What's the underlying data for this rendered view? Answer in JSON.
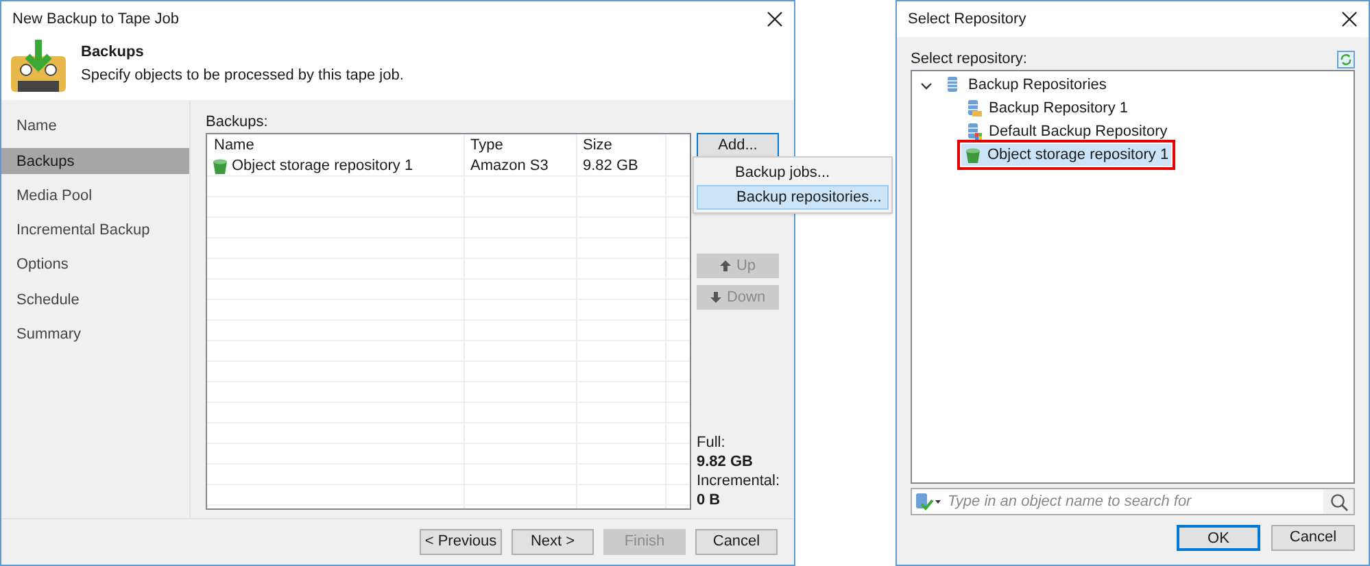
{
  "wizard": {
    "title": "New Backup to Tape Job",
    "header": {
      "title": "Backups",
      "subtitle": "Specify objects to be processed by this tape job."
    },
    "steps": [
      {
        "label": "Name",
        "selected": false
      },
      {
        "label": "Backups",
        "selected": true
      },
      {
        "label": "Media Pool",
        "selected": false
      },
      {
        "label": "Incremental Backup",
        "selected": false
      },
      {
        "label": "Options",
        "selected": false
      },
      {
        "label": "Schedule",
        "selected": false
      },
      {
        "label": "Summary",
        "selected": false
      }
    ],
    "backups_label": "Backups:",
    "table": {
      "columns": [
        "Name",
        "Type",
        "Size"
      ],
      "rows": [
        {
          "name": "Object storage repository 1",
          "type": "Amazon S3",
          "size": "9.82 GB"
        }
      ]
    },
    "side_buttons": [
      {
        "label": "Add...",
        "disabled": false,
        "kind": "plain"
      },
      {
        "label": "Up",
        "disabled": true,
        "kind": "up"
      },
      {
        "label": "Down",
        "disabled": true,
        "kind": "down"
      }
    ],
    "add_menu": [
      {
        "label": "Backup jobs...",
        "selected": false
      },
      {
        "label": "Backup repositories...",
        "selected": true
      }
    ],
    "totals": [
      {
        "label": "Full:",
        "value": "9.82 GB"
      },
      {
        "label": "Incremental:",
        "value": "0 B"
      }
    ],
    "footer_buttons": [
      {
        "label": "< Previous",
        "disabled": false
      },
      {
        "label": "Next >",
        "disabled": false
      },
      {
        "label": "Finish",
        "disabled": true
      },
      {
        "label": "Cancel",
        "disabled": false
      }
    ]
  },
  "repository_dialog": {
    "title": "Select Repository",
    "label": "Select repository:",
    "tree": [
      {
        "label": "Backup Repositories",
        "kind": "group",
        "expanded": true,
        "selected": false,
        "children": [
          {
            "label": "Backup Repository 1",
            "kind": "repository",
            "selected": false
          },
          {
            "label": "Default Backup Repository",
            "kind": "default",
            "selected": false
          },
          {
            "label": "Object storage repository 1",
            "kind": "object",
            "selected": true
          }
        ]
      }
    ],
    "search": {
      "placeholder": "Type in an object name to search for"
    },
    "buttons": [
      {
        "label": "OK",
        "default": true
      },
      {
        "label": "Cancel",
        "default": false
      }
    ]
  }
}
